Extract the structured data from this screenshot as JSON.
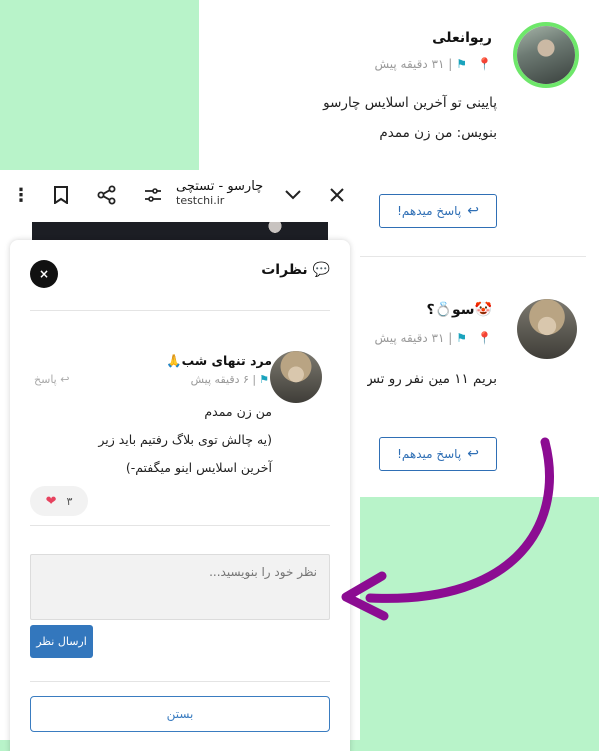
{
  "colors": {
    "green_bg": "#b8f3c9",
    "accent_blue": "#2f6fb5",
    "arrow_purple": "#8c0c92",
    "heart": "#e7435f"
  },
  "comments": [
    {
      "name": "ریوانعلی",
      "meta_time": "۳۱ دقیقه پیش",
      "text": "پایینی تو آخرین اسلایس چارسو بنویس: من زن ممدم",
      "reply_label": "پاسخ میدهم!"
    },
    {
      "name": "سو💍؟🤡",
      "meta_time": "۳۱ دقیقه پیش",
      "text": "بریم ۱۱ مین نفر رو تس",
      "reply_label": "پاسخ میدهم!"
    }
  ],
  "toolbar": {
    "title": "چارسو - تستچی",
    "url": "testchi.ir",
    "icons": [
      "close-icon",
      "chevron-down-icon",
      "tune-icon",
      "share-icon",
      "bookmark-icon",
      "more-vert-icon"
    ]
  },
  "modal": {
    "title": "💬 نظرات",
    "close_icon": "×",
    "comment": {
      "name": "مرد تنهای شب🙏",
      "meta_time": "۶ دقیقه پیش",
      "reply_label": "پاسخ",
      "text_lines": [
        "من زن ممدم",
        "(یه چالش توی بلاگ رفتیم باید زیر",
        "آخرین اسلایس اینو میگفتم-)"
      ],
      "likes": "۳"
    },
    "input_placeholder": "نظر خود را بنویسید...",
    "send_label": "ارسال نظر",
    "close_label": "بستن"
  }
}
